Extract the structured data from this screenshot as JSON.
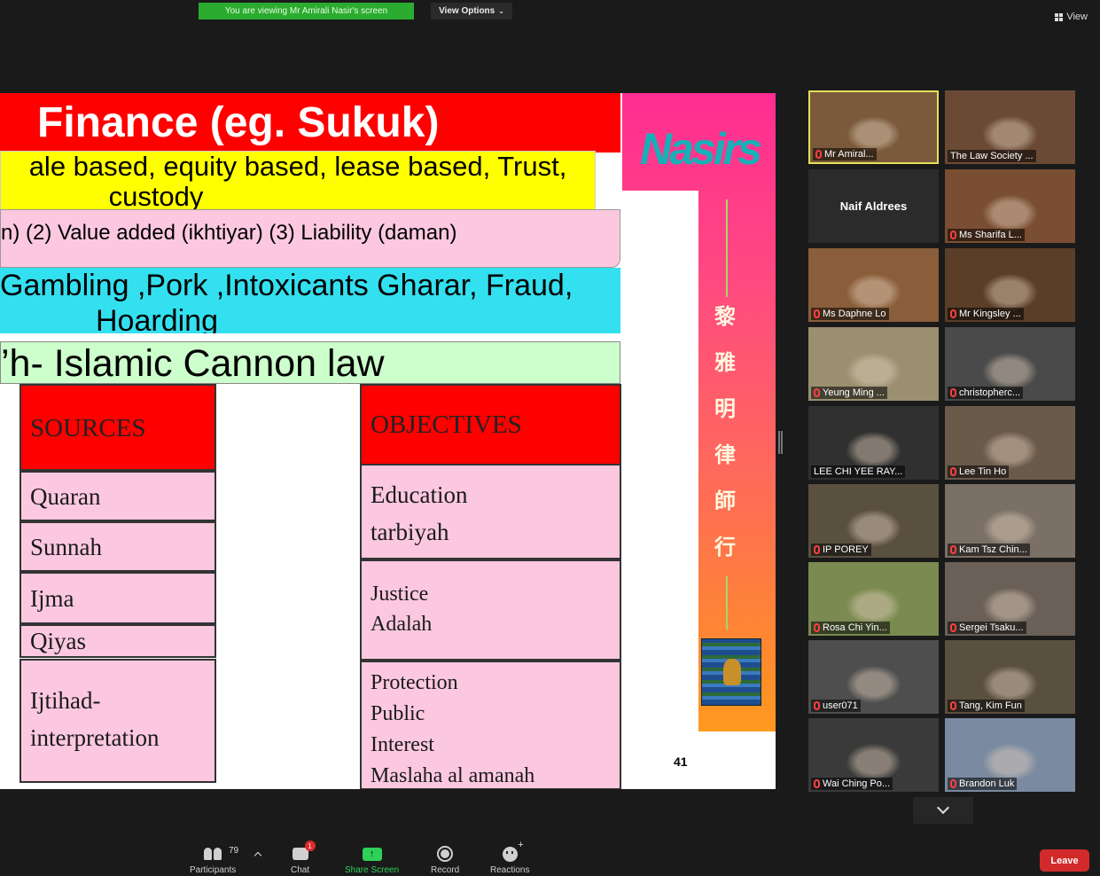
{
  "top_bar": {
    "share_banner": "You are viewing Mr Amirali Nasir's screen",
    "view_options": "View Options",
    "view_button": "View"
  },
  "slide": {
    "title_band": "Finance (eg. Sukuk)",
    "yellow_line1": "ale based, equity based, lease based, Trust,",
    "yellow_line2": "custody",
    "pink_band": "n)  (2) Value added (ikhtiyar) (3) Liability (daman)",
    "cyan_line1": "Gambling ,Pork ,Intoxicants Gharar,  Fraud,",
    "cyan_line2": "Hoarding",
    "green_band": "’h- Islamic Cannon law",
    "sources_header": "SOURCES",
    "sources": [
      "Quaran",
      "Sunnah",
      "Ijma",
      "Qiyas",
      "Ijtihad-",
      "interpretation"
    ],
    "objectives_header": "OBJECTIVES",
    "objectives": {
      "education": [
        "Education",
        "tarbiyah"
      ],
      "justice": [
        "Justice",
        "Adalah"
      ],
      "protection": [
        "Protection",
        "Public",
        "Interest",
        "Maslaha al amanah"
      ]
    },
    "logo_text": "Nasirs",
    "chinese_chars": [
      "黎",
      "雅",
      "明",
      "律",
      "師",
      "行"
    ],
    "page_number": "41"
  },
  "participants": [
    {
      "name": "Mr Amiral...",
      "muted": true,
      "active": true,
      "bg": "#7a5a3a"
    },
    {
      "name": "The Law Society ...",
      "muted": false,
      "active": false,
      "bg": "#6a4a35"
    },
    {
      "name": "Naif Aldrees",
      "muted": false,
      "active": false,
      "bg": "#2b2b2b",
      "no_video": true
    },
    {
      "name": "Ms Sharifa L...",
      "muted": true,
      "active": false,
      "bg": "#7a4e32"
    },
    {
      "name": "Ms Daphne Lo",
      "muted": true,
      "active": false,
      "bg": "#8a5e3a"
    },
    {
      "name": "Mr Kingsley ...",
      "muted": true,
      "active": false,
      "bg": "#5a3e28"
    },
    {
      "name": "Yeung Ming ...",
      "muted": true,
      "active": false,
      "bg": "#9a9070"
    },
    {
      "name": "christopherc...",
      "muted": true,
      "active": false,
      "bg": "#4a4a4a"
    },
    {
      "name": "LEE CHI YEE RAY...",
      "muted": false,
      "active": false,
      "bg": "#303030"
    },
    {
      "name": "Lee Tin Ho",
      "muted": true,
      "active": false,
      "bg": "#6a5a4a"
    },
    {
      "name": "IP POREY",
      "muted": true,
      "active": false,
      "bg": "#5a5040"
    },
    {
      "name": "Kam Tsz Chin...",
      "muted": true,
      "active": false,
      "bg": "#7a7066"
    },
    {
      "name": "Rosa Chi Yin...",
      "muted": true,
      "active": false,
      "bg": "#7a8a50"
    },
    {
      "name": "Sergei Tsaku...",
      "muted": true,
      "active": false,
      "bg": "#6a6058"
    },
    {
      "name": "user071",
      "muted": true,
      "active": false,
      "bg": "#4e4e4e"
    },
    {
      "name": "Tang, Kim Fun",
      "muted": true,
      "active": false,
      "bg": "#5a5040"
    },
    {
      "name": "Wai Ching Po...",
      "muted": true,
      "active": false,
      "bg": "#3a3a3a"
    },
    {
      "name": "Brandon Luk",
      "muted": true,
      "active": false,
      "bg": "#7a8aa0"
    }
  ],
  "toolbar": {
    "participants_label": "Participants",
    "participants_count": "79",
    "chat_label": "Chat",
    "chat_badge": "1",
    "share_label": "Share Screen",
    "record_label": "Record",
    "reactions_label": "Reactions",
    "leave_label": "Leave"
  }
}
